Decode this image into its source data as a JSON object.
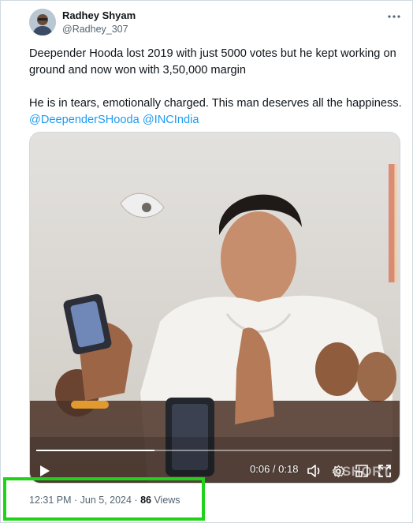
{
  "tweet": {
    "author": {
      "display_name": "Radhey Shyam",
      "handle": "@Radhey_307",
      "avatar": "avatar"
    },
    "more_icon": "more-horizontal-icon",
    "text_line1": "Deepender Hooda lost 2019 with just 5000 votes but he kept working on ground and now won with 3,50,000 margin",
    "text_line2": "He is in tears, emotionally charged. This man deserves all the happiness.",
    "mention1": "@DeependerSHooda",
    "mention2": "@INCIndia",
    "timestamp": "12:31 PM · Jun 5, 2024 · ",
    "views_count": "86",
    "views_label": " Views"
  },
  "video": {
    "time_display": "0:06 / 0:18",
    "watermark": "bSHORT",
    "progress": 0.333,
    "controls": {
      "play_icon": "play-icon",
      "volume_icon": "volume-icon",
      "settings_icon": "gear-icon",
      "pip_icon": "picture-in-picture-icon",
      "fullscreen_icon": "fullscreen-icon"
    }
  },
  "colors": {
    "link": "#1d9bf0",
    "highlight_border": "#22d11a",
    "secondary_text": "#536471"
  }
}
